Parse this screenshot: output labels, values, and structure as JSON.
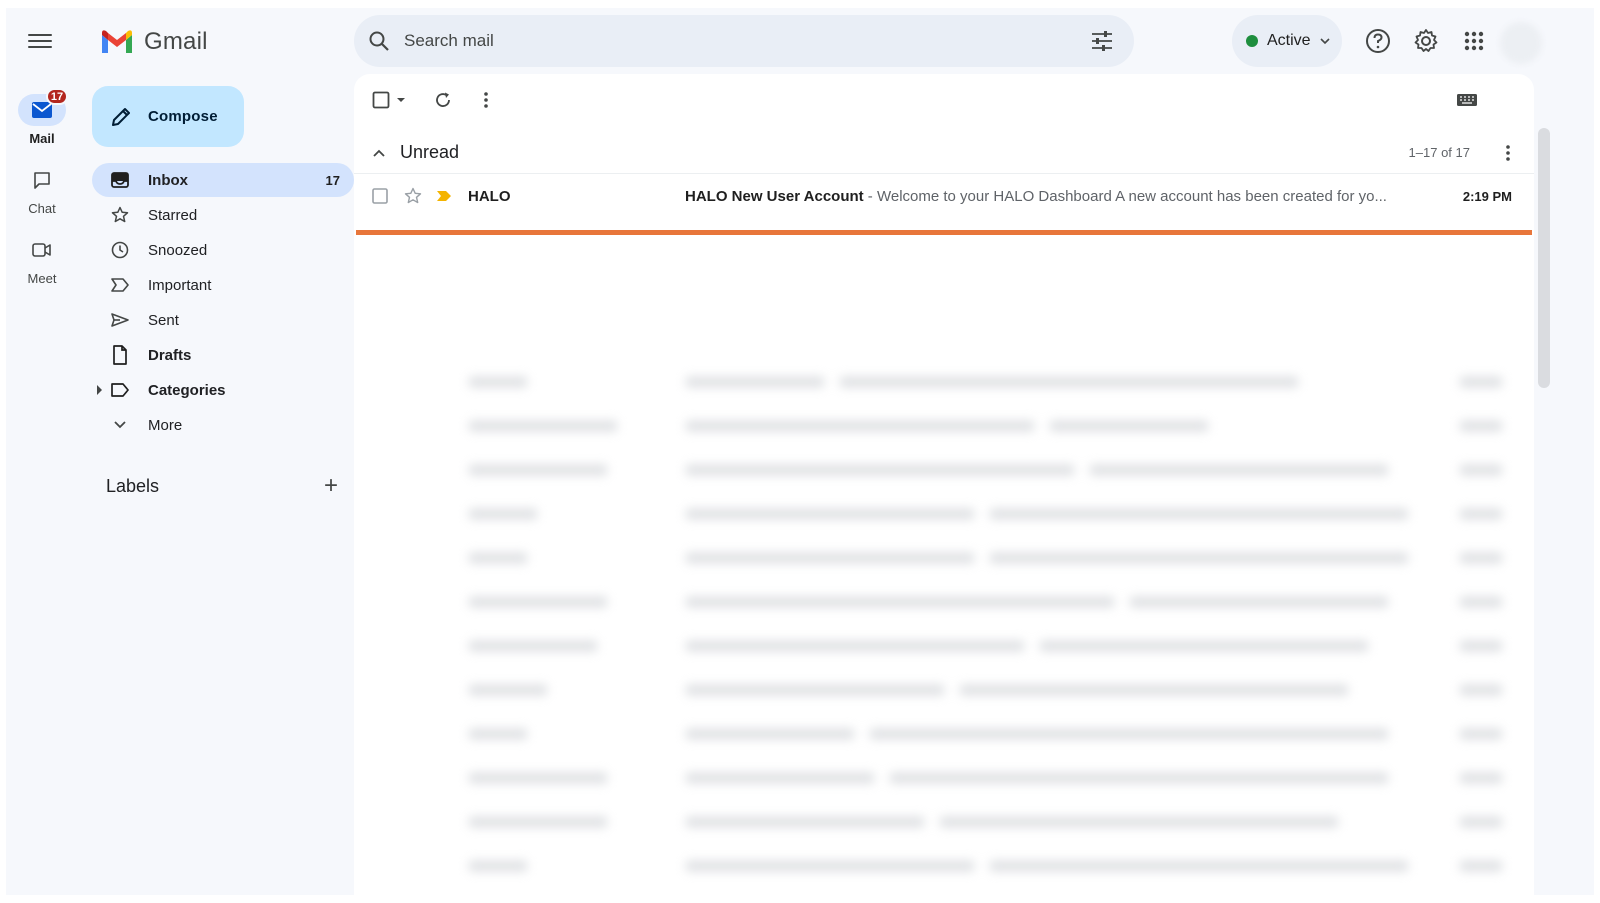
{
  "app": {
    "name": "Gmail"
  },
  "rail": {
    "items": [
      {
        "label": "Mail",
        "badge": "17",
        "icon": "mail-icon"
      },
      {
        "label": "Chat",
        "icon": "chat-icon"
      },
      {
        "label": "Meet",
        "icon": "video-icon"
      }
    ]
  },
  "compose": {
    "label": "Compose"
  },
  "nav": {
    "items": [
      {
        "label": "Inbox",
        "count": "17",
        "icon": "inbox-icon"
      },
      {
        "label": "Starred",
        "icon": "star-icon"
      },
      {
        "label": "Snoozed",
        "icon": "clock-icon"
      },
      {
        "label": "Important",
        "icon": "important-icon"
      },
      {
        "label": "Sent",
        "icon": "send-icon"
      },
      {
        "label": "Drafts",
        "icon": "draft-icon"
      },
      {
        "label": "Categories",
        "icon": "label-icon"
      },
      {
        "label": "More",
        "icon": "chevron-down-icon"
      }
    ]
  },
  "labels": {
    "title": "Labels"
  },
  "search": {
    "placeholder": "Search mail"
  },
  "status": {
    "label": "Active",
    "color": "#1e8e3e"
  },
  "list": {
    "section_title": "Unread",
    "range": "1–17 of 17",
    "rows": [
      {
        "sender": "HALO",
        "subject": "HALO New User Account",
        "snippet": " - Welcome to your HALO Dashboard A new account has been created for yo...",
        "time": "2:19 PM"
      }
    ]
  },
  "colors": {
    "accent": "#d3e3fd",
    "compose": "#c2e7ff",
    "progress": "#e8763b",
    "badge": "#b3261e"
  }
}
